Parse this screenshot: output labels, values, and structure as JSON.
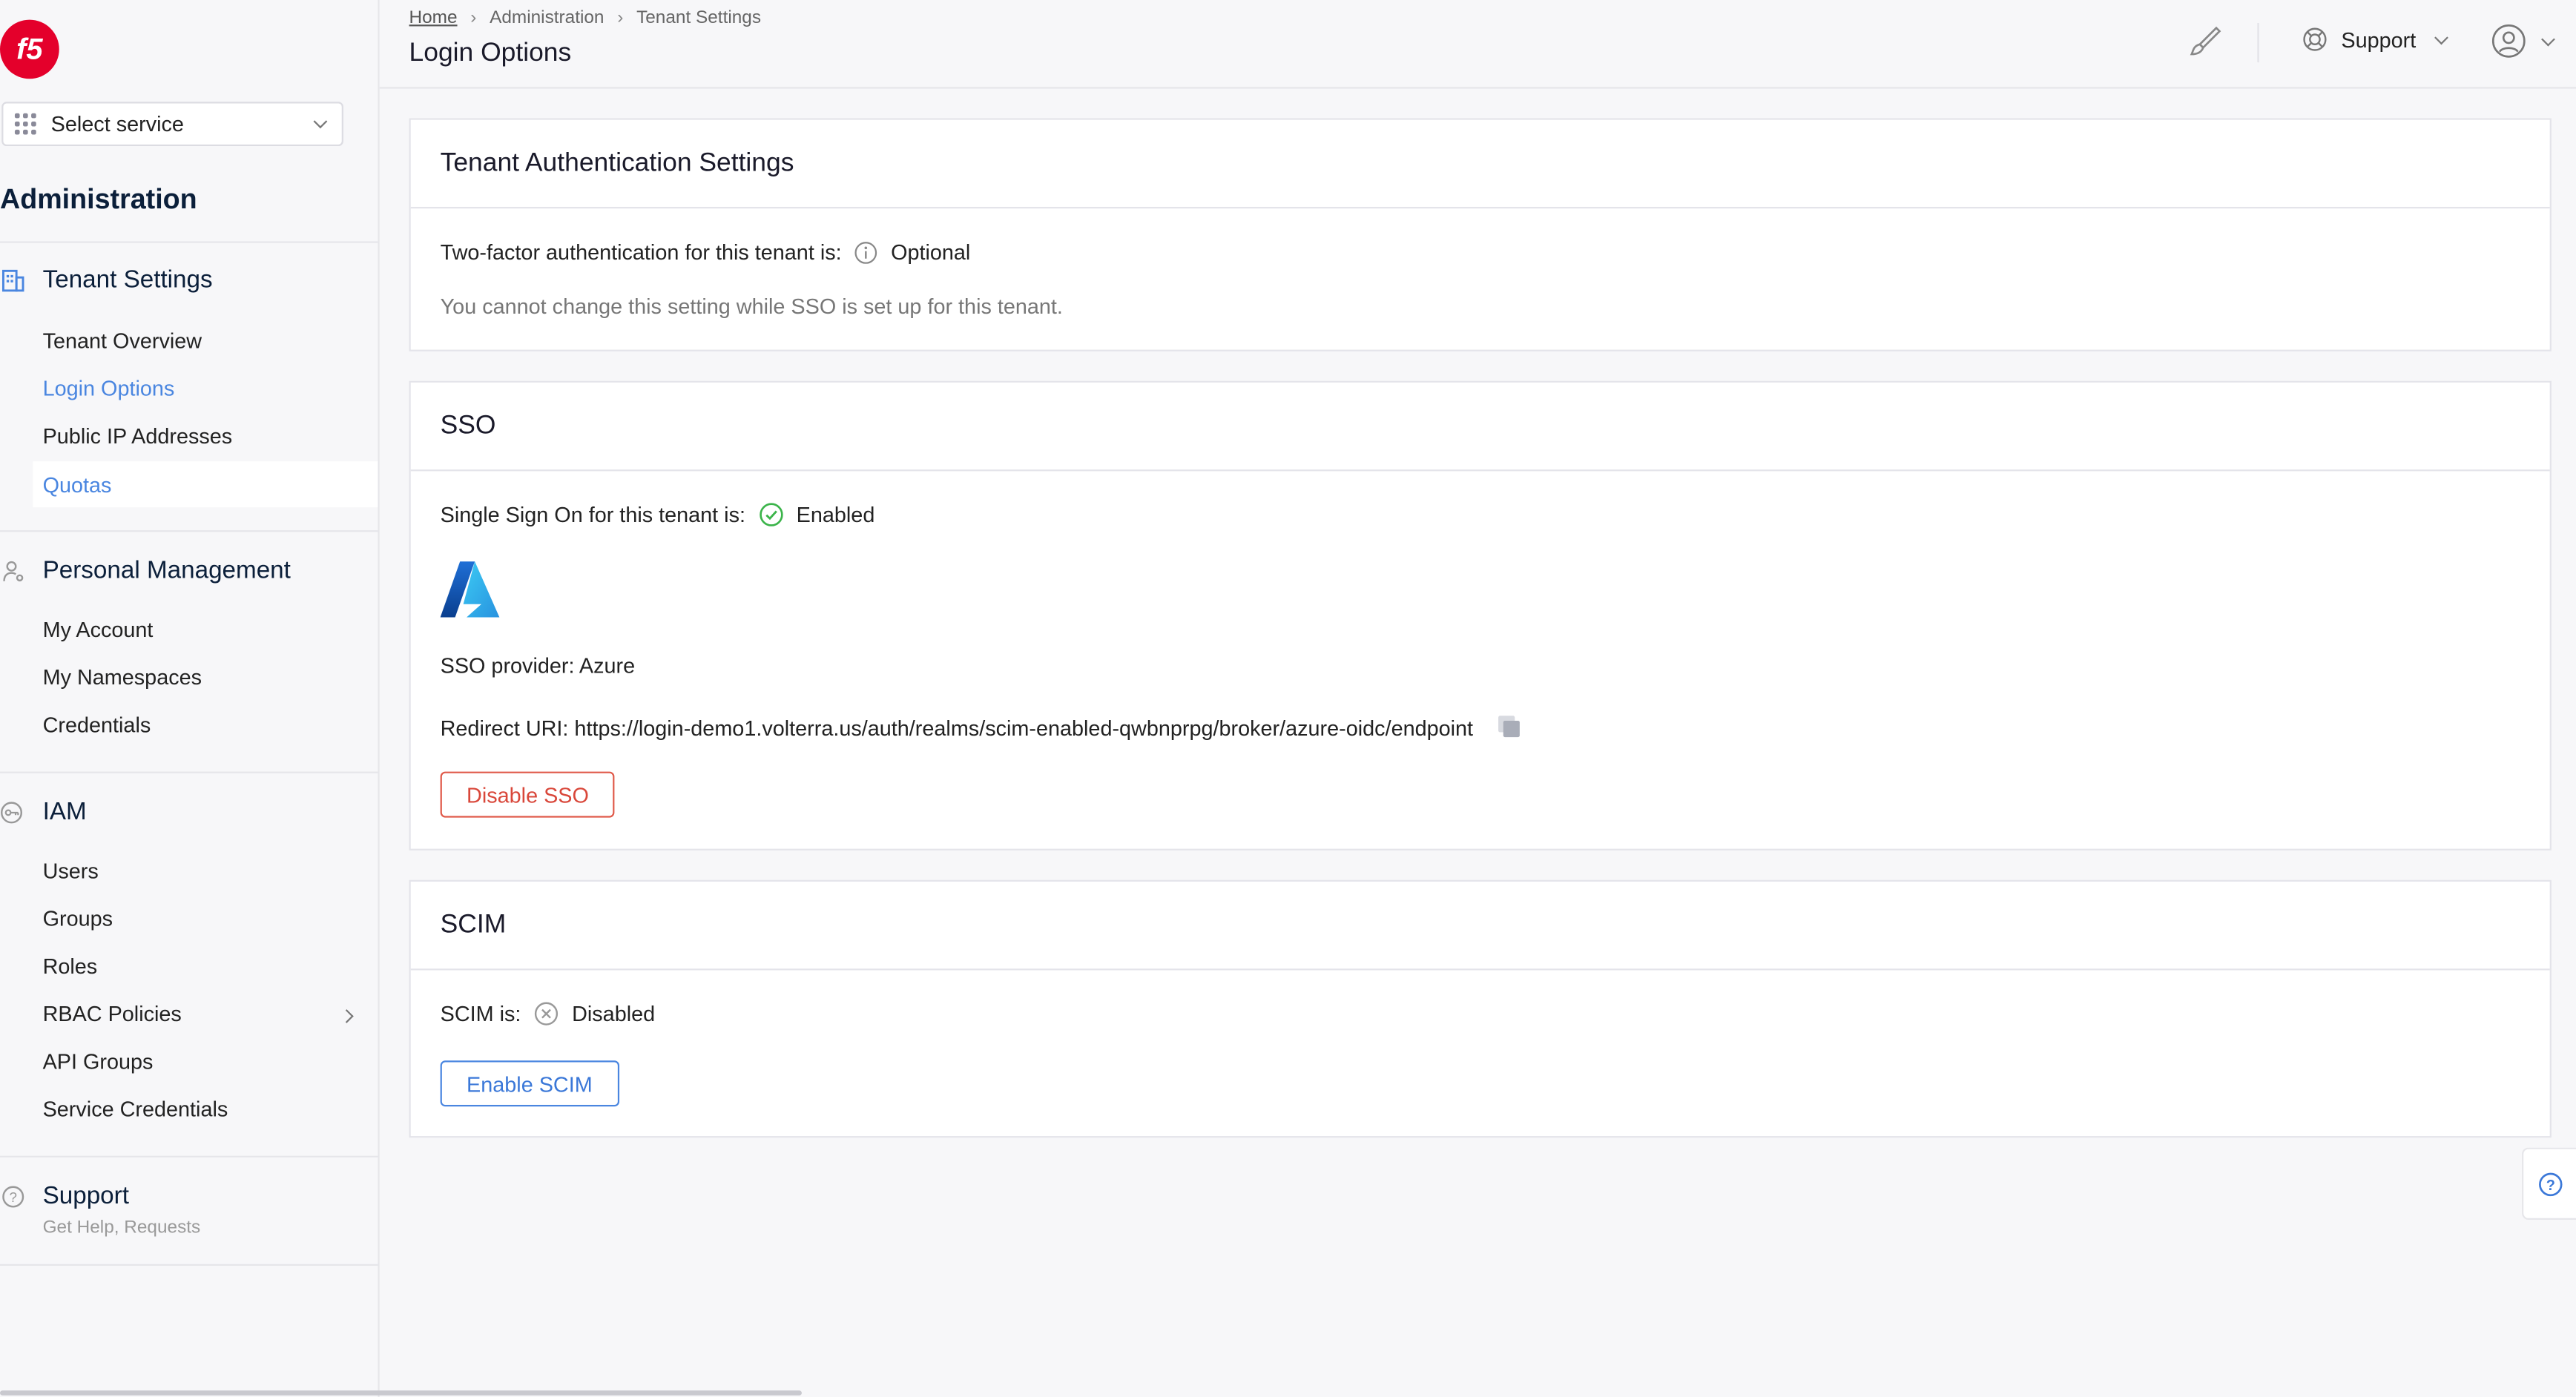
{
  "sidebar": {
    "logo_text": "f5",
    "select_service": "Select service",
    "title": "Administration",
    "tenant_settings": {
      "label": "Tenant Settings",
      "items": [
        "Tenant Overview",
        "Login Options",
        "Public IP Addresses",
        "Quotas"
      ]
    },
    "personal_management": {
      "label": "Personal Management",
      "items": [
        "My Account",
        "My Namespaces",
        "Credentials"
      ]
    },
    "iam": {
      "label": "IAM",
      "items": [
        "Users",
        "Groups",
        "Roles",
        "RBAC Policies",
        "API Groups",
        "Service Credentials"
      ]
    },
    "support": {
      "label": "Support",
      "sub": "Get Help, Requests"
    }
  },
  "header": {
    "breadcrumb": [
      "Home",
      "Administration",
      "Tenant Settings"
    ],
    "title": "Login Options",
    "support_label": "Support"
  },
  "tenant_auth": {
    "title": "Tenant Authentication Settings",
    "twofa_label": "Two-factor authentication for this tenant is:",
    "twofa_value": "Optional",
    "note": "You cannot change this setting while SSO is set up for this tenant."
  },
  "sso": {
    "title": "SSO",
    "status_label": "Single Sign On for this tenant is:",
    "status_value": "Enabled",
    "provider": "SSO provider: Azure",
    "redirect": "Redirect URI: https://login-demo1.volterra.us/auth/realms/scim-enabled-qwbnprpg/broker/azure-oidc/endpoint",
    "disable_button": "Disable SSO"
  },
  "scim": {
    "title": "SCIM",
    "status_label": "SCIM is:",
    "status_value": "Disabled",
    "enable_button": "Enable SCIM"
  },
  "colors": {
    "accent": "#4a86e0",
    "danger": "#d9473a",
    "success": "#3bb44a",
    "brand": "#e4002b"
  }
}
